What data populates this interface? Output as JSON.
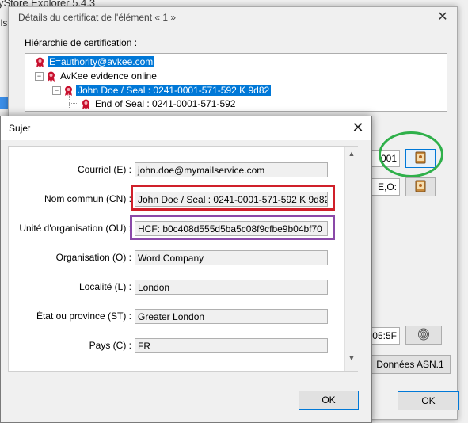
{
  "app": {
    "title": "yStore Explorer 5.4.3",
    "menu_fragment": "ils"
  },
  "outer_dialog": {
    "title": "Détails du certificat de l'élément « 1 »",
    "close_symbol": "✕",
    "hierarchy_label": "Hiérarchie de certification :",
    "tree": [
      {
        "label": "E=authority@avkee.com",
        "selected": true
      },
      {
        "label": "AvKee evidence online",
        "selected": false,
        "expander": "−"
      },
      {
        "label": "John Doe / Seal : 0241-0001-571-592 K 9d82",
        "selected": true,
        "expander": "−"
      },
      {
        "label": "End of Seal : 0241-0001-571-592",
        "selected": false
      }
    ],
    "field_fragment_1": "001",
    "field_fragment_2": "E,O:",
    "field_fragment_3": ":05:5F",
    "asn_button": "Données ASN.1",
    "ok_button": "OK",
    "icons": [
      "certificate-book-icon",
      "certificate-book-icon",
      "fingerprint-icon"
    ]
  },
  "sujet_dialog": {
    "title": "Sujet",
    "close_symbol": "✕",
    "fields": [
      {
        "label": "Courriel (E) :",
        "value": "john.doe@mymailservice.com"
      },
      {
        "label": "Nom commun (CN) :",
        "value": "John Doe / Seal : 0241-0001-571-592 K 9d82"
      },
      {
        "label": "Unité d'organisation (OU) :",
        "value": "HCF: b0c408d555d5ba5c08f9cfbe9b04bf70"
      },
      {
        "label": "Organisation (O) :",
        "value": "Word Company"
      },
      {
        "label": "Localité (L) :",
        "value": "London"
      },
      {
        "label": "État ou province (ST) :",
        "value": "Greater London"
      },
      {
        "label": "Pays (C) :",
        "value": "FR"
      }
    ],
    "scroll_up": "▲",
    "scroll_down": "▼",
    "ok_button": "OK"
  },
  "colors": {
    "selection": "#0078d7",
    "highlight_red": "#d0202a",
    "highlight_purple": "#8a49a8",
    "highlight_green": "#2fb04a"
  }
}
